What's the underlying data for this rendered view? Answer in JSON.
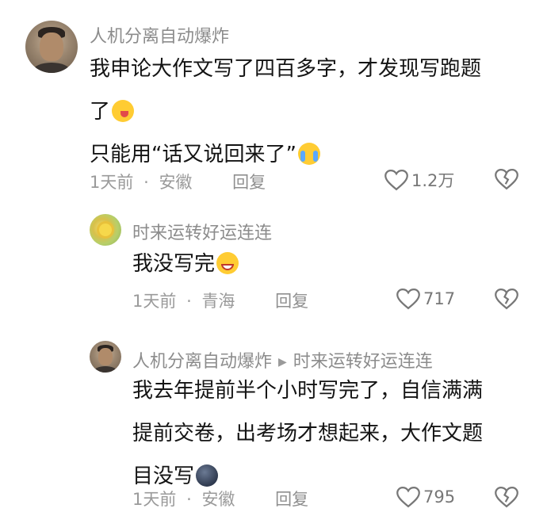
{
  "comments": [
    {
      "username": "人机分离自动爆炸",
      "text_lines": [
        "我申论大作文写了四百多字，才发现写跑题",
        "了",
        "只能用“话又说回来了”"
      ],
      "emoji_icons": [
        "wink-tongue-emoji",
        "crying-emoji"
      ],
      "time": "1天前",
      "location": "安徽",
      "reply_label": "回复",
      "likes": "1.2万"
    },
    {
      "username": "时来运转好运连连",
      "text_lines": [
        "我没写完"
      ],
      "emoji_icons": [
        "sweat-smile-emoji"
      ],
      "time": "1天前",
      "location": "青海",
      "reply_label": "回复",
      "likes": "717"
    },
    {
      "username": "人机分离自动爆炸",
      "reply_to": "时来运转好运连连",
      "text_lines": [
        "我去年提前半个小时写完了，自信满满",
        "提前交卷，出考场才想起来，大作文题",
        "目没写"
      ],
      "emoji_icons": [
        "dark-moon-emoji"
      ],
      "time": "1天前",
      "location": "安徽",
      "reply_label": "回复",
      "likes": "795"
    }
  ],
  "separator": "·",
  "icons": {
    "like": "heart-outline-icon",
    "dislike": "broken-heart-icon",
    "reply_arrow": "triangle-right-icon"
  },
  "colors": {
    "meta_gray": "#9a9a9a",
    "text": "#141414"
  }
}
